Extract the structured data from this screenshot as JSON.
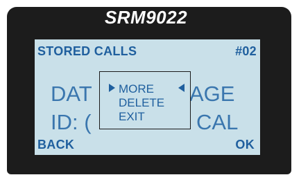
{
  "device": {
    "model": "SRM9022"
  },
  "screen": {
    "title": "STORED CALLS",
    "entry_number": "#02",
    "background_text": {
      "line1_left": "DAT",
      "line1_right": "AGE",
      "line2_left": "ID:  (",
      "line2_right": "CAL"
    },
    "popup_menu": {
      "items": [
        "MORE",
        "DELETE",
        "EXIT"
      ],
      "selected": "MORE"
    },
    "softkeys": {
      "left": "BACK",
      "right": "OK"
    }
  },
  "colors": {
    "device_body": "#1c1c1c",
    "screen_background": "#c9e0e9",
    "text": "#1f5f9e",
    "model_text": "#ffffff"
  }
}
